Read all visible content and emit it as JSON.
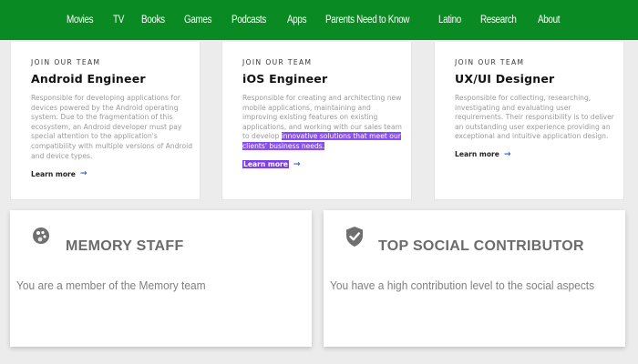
{
  "nav": {
    "items": [
      "Movies",
      "TV",
      "Books",
      "Games",
      "Podcasts",
      "Apps",
      "Parents Need to Know",
      "Latino",
      "Research",
      "About"
    ]
  },
  "jobs": [
    {
      "eyebrow": "JOIN OUR TEAM",
      "title": "Android Engineer",
      "desc": "Responsible for developing applications for devices powered by the Android operating system. Due to the fragmentation of this ecosystem, an Android developer must pay special attention to the application's compatibility with multiple versions of Android and device types.",
      "desc_highlight": "",
      "cta": "Learn more",
      "arrow": "→"
    },
    {
      "eyebrow": "JOIN OUR TEAM",
      "title": "iOS Engineer",
      "desc": "Responsible for creating and architecting new mobile applications, maintaining and improving existing features on existing applications, and working with our sales team to develop ",
      "desc_highlight": "innovative solutions that meet our clients' business needs.",
      "cta": "Learn more",
      "arrow": "→"
    },
    {
      "eyebrow": "JOIN OUR TEAM",
      "title": "UX/UI Designer",
      "desc": "Responsible for collecting, researching, investigating and evaluating user requirements. Their responsibility is to deliver an outstanding user experience providing an exceptional and intuitive application design.",
      "desc_highlight": "",
      "cta": "Learn more",
      "arrow": "→"
    }
  ],
  "achievements": [
    {
      "icon": "palette-icon",
      "title": "MEMORY STAFF",
      "desc": "You are a member of the Memory team"
    },
    {
      "icon": "shield-check-icon",
      "title": "TOP SOCIAL CONTRIBUTOR",
      "desc": "You have a high contribution level to the social aspects"
    }
  ],
  "colors": {
    "nav_bg": "#0a8a22",
    "highlight": "#8a4ff0",
    "arrow": "#2b5fd9"
  }
}
